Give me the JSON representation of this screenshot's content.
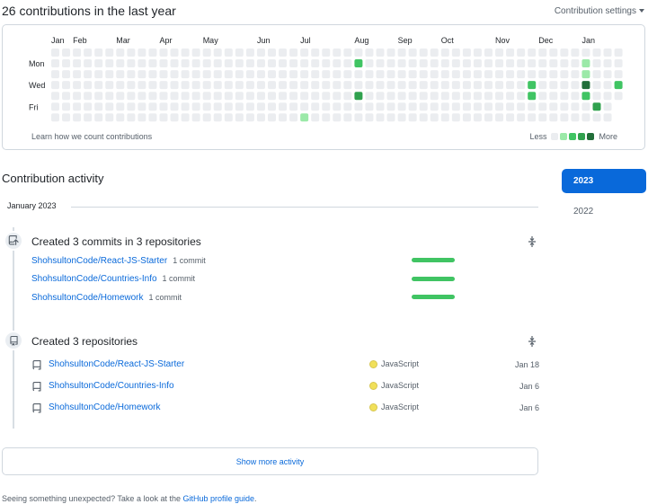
{
  "header": {
    "title": "26 contributions in the last year",
    "settings_label": "Contribution settings"
  },
  "graph": {
    "months": [
      "Jan",
      "Feb",
      "Mar",
      "Apr",
      "May",
      "Jun",
      "Jul",
      "Aug",
      "Sep",
      "Oct",
      "Nov",
      "Dec",
      "Jan"
    ],
    "day_labels": [
      "Mon",
      "Wed",
      "Fri"
    ],
    "learn_link": "Learn how we count contributions",
    "legend_less": "Less",
    "legend_more": "More",
    "colors": [
      "#ebedf0",
      "#9be9a8",
      "#40c463",
      "#30a14e",
      "#216e39"
    ],
    "weeks": 53,
    "nonzero_cells": [
      {
        "week": 27,
        "day": 6,
        "level": 1
      },
      {
        "week": 32,
        "day": 1,
        "level": 2
      },
      {
        "week": 32,
        "day": 4,
        "level": 3
      },
      {
        "week": 48,
        "day": 3,
        "level": 2
      },
      {
        "week": 48,
        "day": 4,
        "level": 2
      },
      {
        "week": 53,
        "day": 1,
        "level": 1
      },
      {
        "week": 53,
        "day": 2,
        "level": 1
      },
      {
        "week": 53,
        "day": 3,
        "level": 4
      },
      {
        "week": 53,
        "day": 4,
        "level": 2
      },
      {
        "week": 54,
        "day": 5,
        "level": 3
      },
      {
        "week": 56,
        "day": 3,
        "level": 2
      }
    ]
  },
  "activity": {
    "title": "Contribution activity",
    "month_label": "January 2023",
    "years": [
      "2023",
      "2022"
    ],
    "commits_heading": "Created 3 commits in 3 repositories",
    "commit_repos": [
      {
        "name": "ShohsultonCode/React-JS-Starter",
        "count": "1 commit"
      },
      {
        "name": "ShohsultonCode/Countries-Info",
        "count": "1 commit"
      },
      {
        "name": "ShohsultonCode/Homework",
        "count": "1 commit"
      }
    ],
    "repos_heading": "Created 3 repositories",
    "created_repos": [
      {
        "name": "ShohsultonCode/React-JS-Starter",
        "language": "JavaScript",
        "date": "Jan 18"
      },
      {
        "name": "ShohsultonCode/Countries-Info",
        "language": "JavaScript",
        "date": "Jan 6"
      },
      {
        "name": "ShohsultonCode/Homework",
        "language": "JavaScript",
        "date": "Jan 6"
      }
    ],
    "show_more": "Show more activity"
  },
  "footer": {
    "prefix": "Seeing something unexpected? Take a look at the ",
    "link": "GitHub profile guide",
    "suffix": "."
  },
  "icons": {
    "repo_push": "repo-push-icon",
    "repo": "repo-icon",
    "fold": "fold-icon",
    "caret": "triangle-down-icon"
  }
}
